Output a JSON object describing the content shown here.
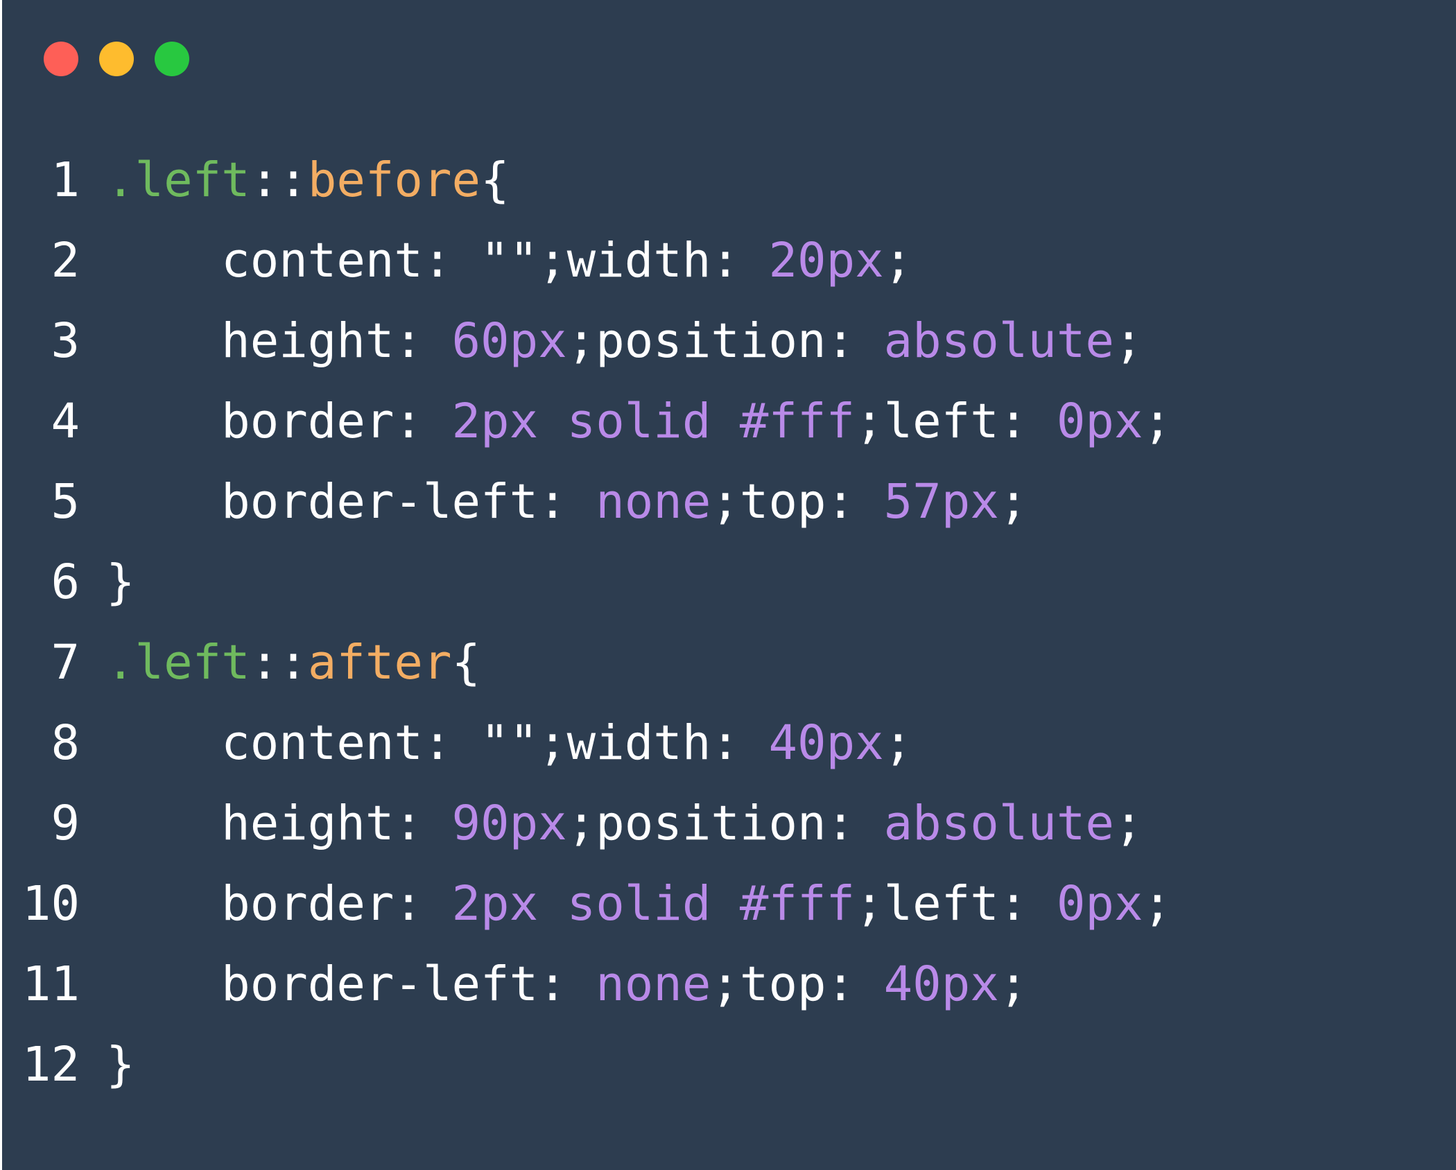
{
  "window": {
    "background": "#2d3d50",
    "controls": [
      {
        "name": "close",
        "color": "#fe5f57"
      },
      {
        "name": "minimize",
        "color": "#febc2e"
      },
      {
        "name": "zoom",
        "color": "#28c840"
      }
    ]
  },
  "colors": {
    "selector": "#6fba5e",
    "pseudo": "#f3ad63",
    "value": "#b98ae8",
    "text": "#ffffff"
  },
  "code": {
    "lines": [
      {
        "n": "1",
        "tokens": [
          {
            "t": ".left",
            "k": "sel"
          },
          {
            "t": "::",
            "k": "pun"
          },
          {
            "t": "before",
            "k": "pse"
          },
          {
            "t": "{",
            "k": "pun"
          }
        ]
      },
      {
        "n": "2",
        "tokens": [
          {
            "t": "    content: ",
            "k": "prp"
          },
          {
            "t": "\"\"",
            "k": "pun"
          },
          {
            "t": ";width: ",
            "k": "prp"
          },
          {
            "t": "20px",
            "k": "val"
          },
          {
            "t": ";",
            "k": "pun"
          }
        ]
      },
      {
        "n": "3",
        "tokens": [
          {
            "t": "    height: ",
            "k": "prp"
          },
          {
            "t": "60px",
            "k": "val"
          },
          {
            "t": ";position: ",
            "k": "prp"
          },
          {
            "t": "absolute",
            "k": "val"
          },
          {
            "t": ";",
            "k": "pun"
          }
        ]
      },
      {
        "n": "4",
        "tokens": [
          {
            "t": "    border: ",
            "k": "prp"
          },
          {
            "t": "2px solid #fff",
            "k": "val"
          },
          {
            "t": ";left: ",
            "k": "prp"
          },
          {
            "t": "0px",
            "k": "val"
          },
          {
            "t": ";",
            "k": "pun"
          }
        ]
      },
      {
        "n": "5",
        "tokens": [
          {
            "t": "    border-left: ",
            "k": "prp"
          },
          {
            "t": "none",
            "k": "val"
          },
          {
            "t": ";top: ",
            "k": "prp"
          },
          {
            "t": "57px",
            "k": "val"
          },
          {
            "t": ";",
            "k": "pun"
          }
        ]
      },
      {
        "n": "6",
        "tokens": [
          {
            "t": "}",
            "k": "pun"
          }
        ]
      },
      {
        "n": "7",
        "tokens": [
          {
            "t": ".left",
            "k": "sel"
          },
          {
            "t": "::",
            "k": "pun"
          },
          {
            "t": "after",
            "k": "pse"
          },
          {
            "t": "{",
            "k": "pun"
          }
        ]
      },
      {
        "n": "8",
        "tokens": [
          {
            "t": "    content: ",
            "k": "prp"
          },
          {
            "t": "\"\"",
            "k": "pun"
          },
          {
            "t": ";width: ",
            "k": "prp"
          },
          {
            "t": "40px",
            "k": "val"
          },
          {
            "t": ";",
            "k": "pun"
          }
        ]
      },
      {
        "n": "9",
        "tokens": [
          {
            "t": "    height: ",
            "k": "prp"
          },
          {
            "t": "90px",
            "k": "val"
          },
          {
            "t": ";position: ",
            "k": "prp"
          },
          {
            "t": "absolute",
            "k": "val"
          },
          {
            "t": ";",
            "k": "pun"
          }
        ]
      },
      {
        "n": "10",
        "tokens": [
          {
            "t": "    border: ",
            "k": "prp"
          },
          {
            "t": "2px solid #fff",
            "k": "val"
          },
          {
            "t": ";left: ",
            "k": "prp"
          },
          {
            "t": "0px",
            "k": "val"
          },
          {
            "t": ";",
            "k": "pun"
          }
        ]
      },
      {
        "n": "11",
        "tokens": [
          {
            "t": "    border-left: ",
            "k": "prp"
          },
          {
            "t": "none",
            "k": "val"
          },
          {
            "t": ";top: ",
            "k": "prp"
          },
          {
            "t": "40px",
            "k": "val"
          },
          {
            "t": ";",
            "k": "pun"
          }
        ]
      },
      {
        "n": "12",
        "tokens": [
          {
            "t": "}",
            "k": "pun"
          }
        ]
      }
    ]
  }
}
